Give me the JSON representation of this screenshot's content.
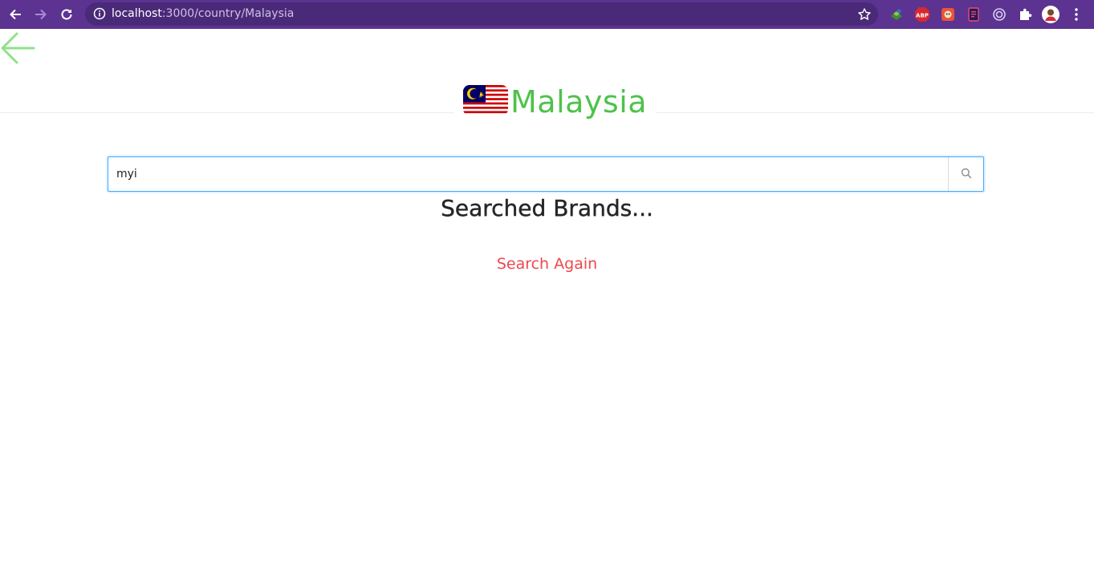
{
  "browser": {
    "url_host": "localhost",
    "url_path": ":3000/country/Malaysia",
    "toolbar_color": "#5c3391"
  },
  "page": {
    "title": "Malaysia",
    "title_color": "#4ec24a",
    "search": {
      "value": "myi"
    },
    "heading": "Searched Brands...",
    "search_again": "Search Again",
    "search_again_color": "#f0464e"
  },
  "icons": [
    "back-arrow-icon",
    "forward-arrow-icon",
    "reload-icon",
    "info-icon",
    "star-icon",
    "extension-globe-icon",
    "adblock-icon",
    "extension-red-icon",
    "extension-doc-icon",
    "extension-ring-icon",
    "puzzle-icon",
    "profile-avatar-icon",
    "kebab-menu-icon",
    "malaysia-flag-icon",
    "search-icon"
  ]
}
